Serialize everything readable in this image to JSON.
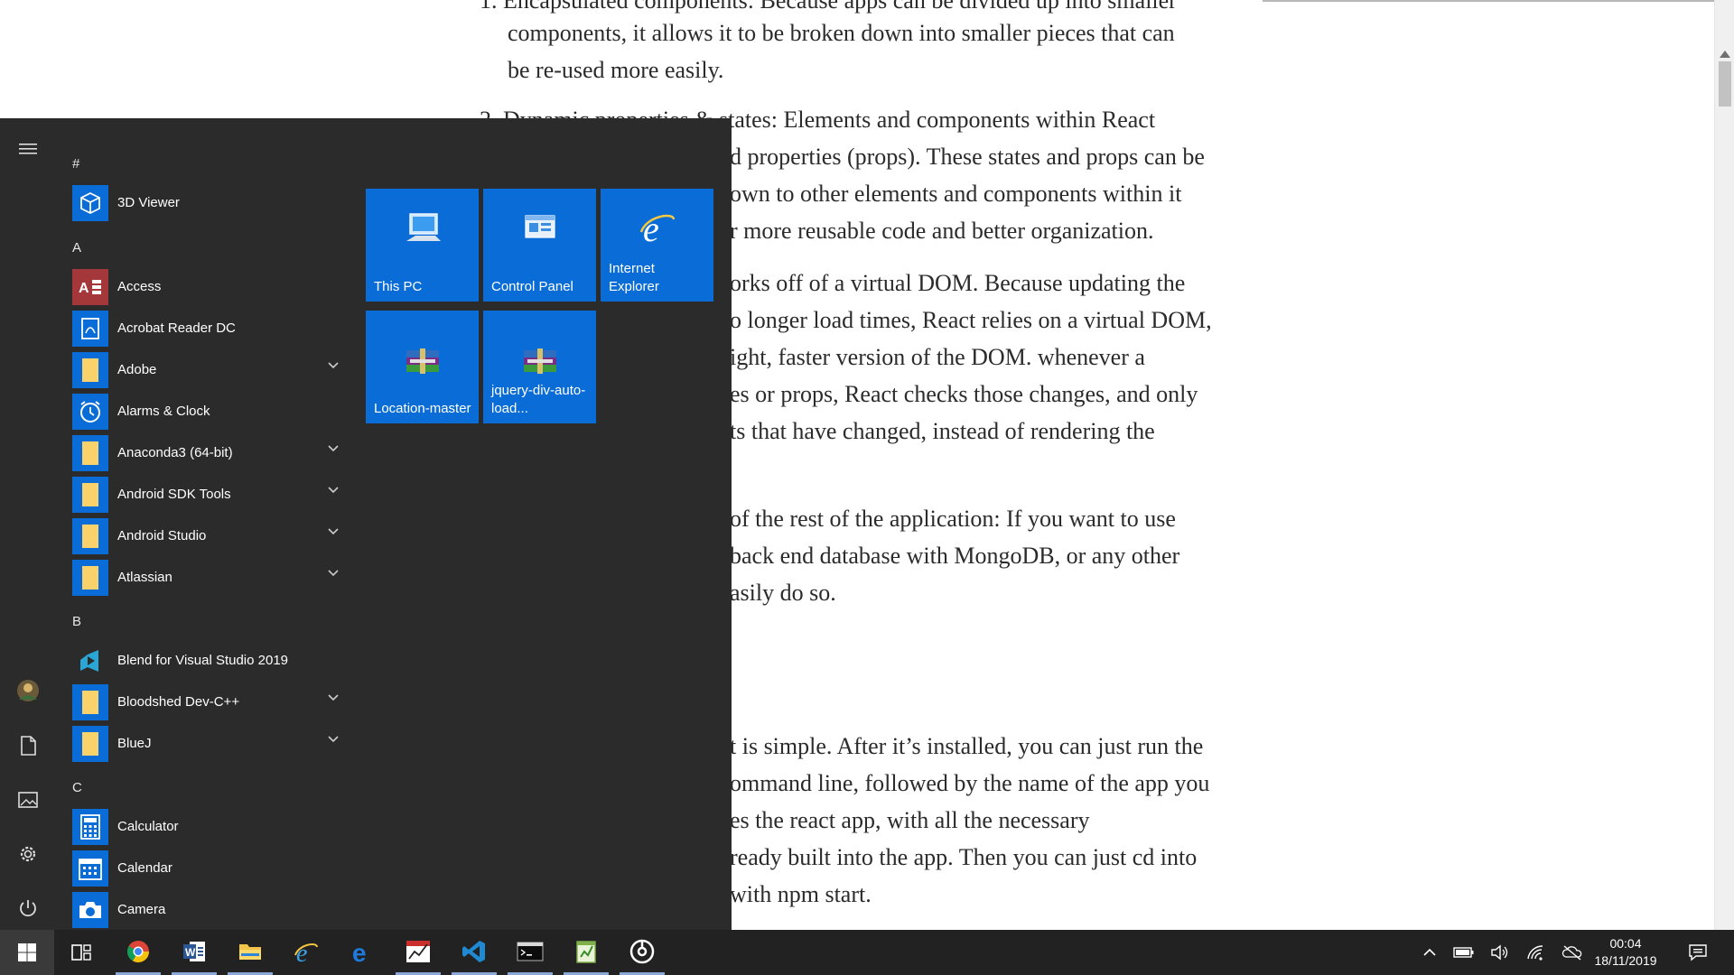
{
  "article": {
    "lines": [
      "1. Encapsulated components: Because apps can be divided up into smaller",
      "components, it allows it to be broken down into smaller pieces that can",
      "be re-used more easily.",
      "2. Dynamic properties & states: Elements and components within React",
      "d properties (props). These states and props can be",
      "own to other elements and components within it",
      "r more reusable code and better organization.",
      "orks off of a virtual DOM. Because updating the",
      "o longer load times, React relies on a virtual DOM,",
      "ight, faster version of the DOM. whenever a",
      "es or props, React checks those changes, and only",
      "ts that have changed, instead of rendering the",
      "of the rest of the application: If you want to use",
      "back end database with MongoDB, or any other",
      "asily do so.",
      "t is simple. After it’s installed, you can just run the",
      "ommand line, followed by the name of the app you",
      "es the react app, with all the necessary",
      "ready built into the app. Then you can just cd into",
      "with npm start."
    ]
  },
  "start_menu": {
    "groups": [
      {
        "letter": "#",
        "apps": [
          {
            "name": "3D Viewer",
            "icon": "cube-icon",
            "expandable": false
          }
        ]
      },
      {
        "letter": "A",
        "apps": [
          {
            "name": "Access",
            "icon": "access-icon",
            "expandable": false
          },
          {
            "name": "Acrobat Reader DC",
            "icon": "acrobat-icon",
            "expandable": false
          },
          {
            "name": "Adobe",
            "icon": "folder-icon",
            "expandable": true
          },
          {
            "name": "Alarms & Clock",
            "icon": "clock-icon",
            "expandable": false
          },
          {
            "name": "Anaconda3 (64-bit)",
            "icon": "folder-icon",
            "expandable": true
          },
          {
            "name": "Android SDK Tools",
            "icon": "folder-icon",
            "expandable": true
          },
          {
            "name": "Android Studio",
            "icon": "folder-icon",
            "expandable": true
          },
          {
            "name": "Atlassian",
            "icon": "folder-icon",
            "expandable": true
          }
        ]
      },
      {
        "letter": "B",
        "apps": [
          {
            "name": "Blend for Visual Studio 2019",
            "icon": "blend-icon",
            "expandable": false
          },
          {
            "name": "Bloodshed Dev-C++",
            "icon": "folder-icon",
            "expandable": true
          },
          {
            "name": "BlueJ",
            "icon": "folder-icon",
            "expandable": true
          }
        ]
      },
      {
        "letter": "C",
        "apps": [
          {
            "name": "Calculator",
            "icon": "calculator-icon",
            "expandable": false
          },
          {
            "name": "Calendar",
            "icon": "calendar-icon",
            "expandable": false
          },
          {
            "name": "Camera",
            "icon": "camera-icon",
            "expandable": false
          }
        ]
      }
    ],
    "tiles": [
      {
        "label": "This PC",
        "icon": "computer-icon"
      },
      {
        "label": "Control Panel",
        "icon": "control-panel-icon"
      },
      {
        "label": "Internet Explorer",
        "icon": "internet-explorer-icon"
      },
      {
        "label": "Location-master",
        "icon": "winrar-icon"
      },
      {
        "label": "jquery-div-auto-load...",
        "icon": "winrar-icon"
      }
    ],
    "rail": [
      "hamburger-icon",
      "user-avatar",
      "documents-icon",
      "pictures-icon",
      "settings-icon",
      "power-icon"
    ]
  },
  "taskbar": {
    "apps": [
      "windows-start-icon",
      "task-view-icon",
      "chrome-icon",
      "word-icon",
      "file-explorer-icon",
      "internet-explorer-icon",
      "edge-icon",
      "chart-app-icon",
      "vscode-icon",
      "terminal-icon",
      "notepad-plus-icon",
      "groove-music-icon"
    ],
    "time": "00:04",
    "date": "18/11/2019"
  },
  "colors": {
    "start_bg": "#2b2b2b",
    "tile_blue": "#0a6cd6",
    "taskbar_bg": "#222222",
    "accent": "#0a6cd6"
  }
}
